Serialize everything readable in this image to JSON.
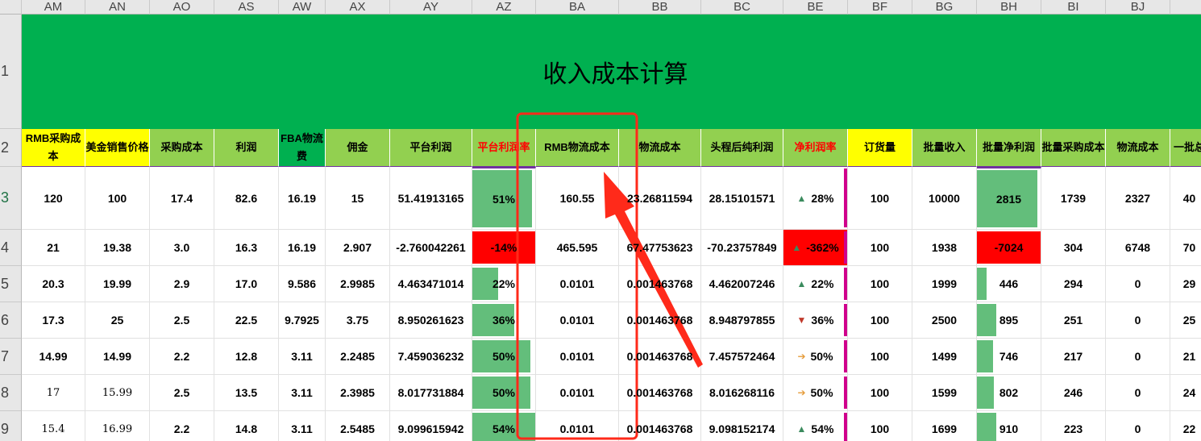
{
  "column_letters": [
    "AM",
    "AN",
    "AO",
    "AS",
    "AW",
    "AX",
    "AY",
    "AZ",
    "BA",
    "BB",
    "BC",
    "BE",
    "BF",
    "BG",
    "BH",
    "BI",
    "BJ",
    ""
  ],
  "row_numbers": [
    "1",
    "2",
    "3",
    "4",
    "5",
    "6",
    "7",
    "8",
    "9"
  ],
  "title": "收入成本计算",
  "headers": [
    "RMB采购成本",
    "美金销售价格",
    "采购成本",
    "利润",
    "FBA物流费",
    "佣金",
    "平台利润",
    "平台利润率",
    "RMB物流成本",
    "物流成本",
    "头程后纯利润",
    "净利润率",
    "订货量",
    "批量收入",
    "批量净利润",
    "批量采购成本",
    "物流成本",
    "一批总"
  ],
  "rows": [
    [
      "120",
      "100",
      "17.4",
      "82.6",
      "16.19",
      "15",
      "51.41913165",
      "51%",
      "160.55",
      "23.26811594",
      "28.15101571",
      "28%",
      "100",
      "10000",
      "2815",
      "1739",
      "2327",
      "40"
    ],
    [
      "21",
      "19.38",
      "3.0",
      "16.3",
      "16.19",
      "2.907",
      "-2.760042261",
      "-14%",
      "465.595",
      "67.47753623",
      "-70.23757849",
      "-362%",
      "100",
      "1938",
      "-7024",
      "304",
      "6748",
      "70"
    ],
    [
      "20.3",
      "19.99",
      "2.9",
      "17.0",
      "9.586",
      "2.9985",
      "4.463471014",
      "22%",
      "0.0101",
      "0.001463768",
      "4.462007246",
      "22%",
      "100",
      "1999",
      "446",
      "294",
      "0",
      "29"
    ],
    [
      "17.3",
      "25",
      "2.5",
      "22.5",
      "9.7925",
      "3.75",
      "8.950261623",
      "36%",
      "0.0101",
      "0.001463768",
      "8.948797855",
      "36%",
      "100",
      "2500",
      "895",
      "251",
      "0",
      "25"
    ],
    [
      "14.99",
      "14.99",
      "2.2",
      "12.8",
      "3.11",
      "2.2485",
      "7.459036232",
      "50%",
      "0.0101",
      "0.001463768",
      "7.457572464",
      "50%",
      "100",
      "1499",
      "746",
      "217",
      "0",
      "21"
    ],
    [
      "17",
      "15.99",
      "2.5",
      "13.5",
      "3.11",
      "2.3985",
      "8.017731884",
      "50%",
      "0.0101",
      "0.001463768",
      "8.016268116",
      "50%",
      "100",
      "1599",
      "802",
      "246",
      "0",
      "24"
    ],
    [
      "15.4",
      "16.99",
      "2.2",
      "14.8",
      "3.11",
      "2.5485",
      "9.099615942",
      "54%",
      "0.0101",
      "0.001463768",
      "9.098152174",
      "54%",
      "100",
      "1699",
      "910",
      "223",
      "0",
      "22"
    ]
  ],
  "databars": {
    "platform_margin": [
      0.51,
      -0.14,
      0.22,
      0.36,
      0.5,
      0.5,
      0.54
    ],
    "batch_profit": [
      2815,
      -7024,
      446,
      895,
      746,
      802,
      910
    ],
    "batch_profit_max": 2815
  },
  "net_margin_icons": [
    "up-arrow-icon",
    "up-arrow-icon",
    "up-arrow-icon",
    "down-arrow-icon",
    "right-arrow-icon",
    "right-arrow-icon",
    "up-arrow-icon"
  ],
  "colors": {
    "title_fill": "#00b050",
    "header_green": "#92d050",
    "header_yellow": "#ffff00",
    "header_dark_green": "#00b050",
    "red_text": "#ff0000",
    "databar_green": "#63be7b",
    "negative_fill": "#ff0000",
    "annotation_red": "#ff2a1a"
  }
}
